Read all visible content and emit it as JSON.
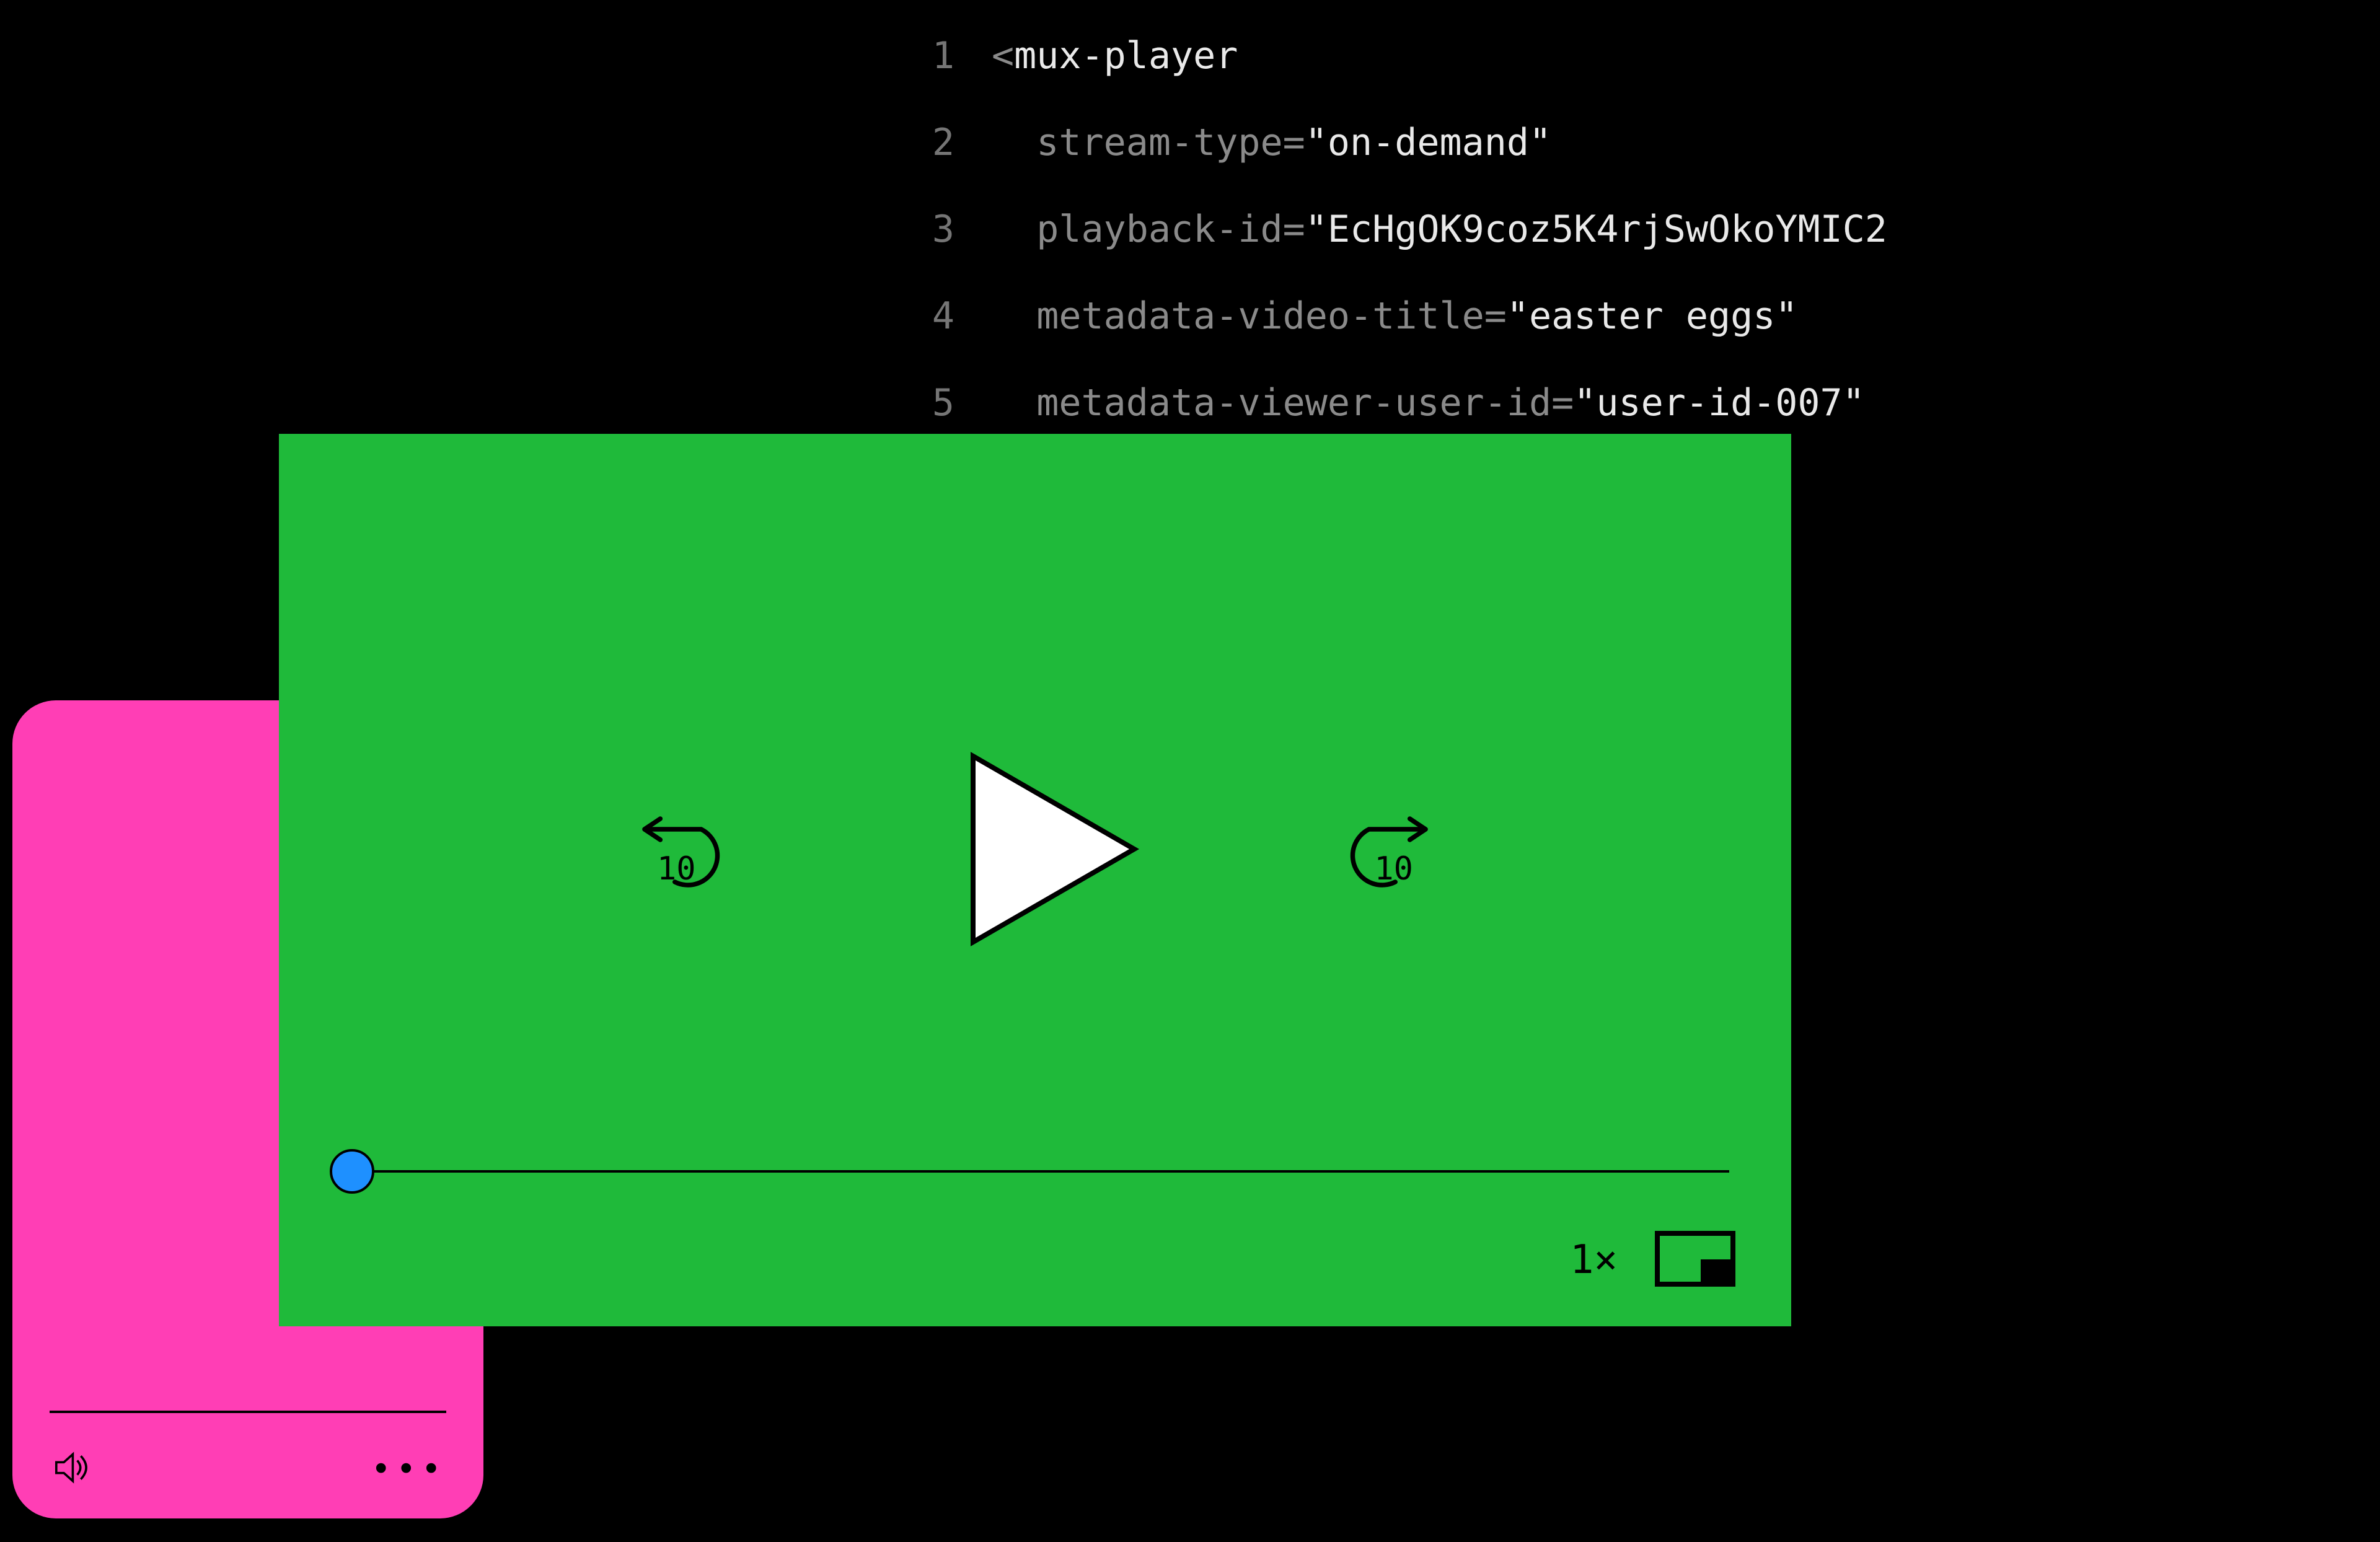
{
  "code": {
    "lines": [
      {
        "n": "1",
        "segs": [
          {
            "t": "<",
            "c": "tok-dim"
          },
          {
            "t": "mux-player",
            "c": "tok-white"
          }
        ]
      },
      {
        "n": "2",
        "segs": [
          {
            "t": "  stream-type=",
            "c": "tok-dim"
          },
          {
            "t": "\"on-demand\"",
            "c": "tok-white"
          }
        ]
      },
      {
        "n": "3",
        "segs": [
          {
            "t": "  playback-id=",
            "c": "tok-dim"
          },
          {
            "t": "\"EcHgOK9coz5K4rjSwOkoYMIC2",
            "c": "tok-white"
          }
        ]
      },
      {
        "n": "4",
        "segs": [
          {
            "t": "  metadata-video-title=",
            "c": "tok-dim"
          },
          {
            "t": "\"easter eggs\"",
            "c": "tok-white"
          }
        ]
      },
      {
        "n": "5",
        "segs": [
          {
            "t": "  metadata-viewer-user-id=",
            "c": "tok-dim"
          },
          {
            "t": "\"user-id-007\"",
            "c": "tok-white"
          }
        ]
      }
    ]
  },
  "player": {
    "skip_seconds": "10",
    "speed_label": "1×"
  },
  "mini": {
    "more_label": "•••"
  },
  "colors": {
    "bg": "#000000",
    "green": "#1fba3a",
    "pink": "#ff3eb5",
    "thumb": "#1e90ff"
  }
}
